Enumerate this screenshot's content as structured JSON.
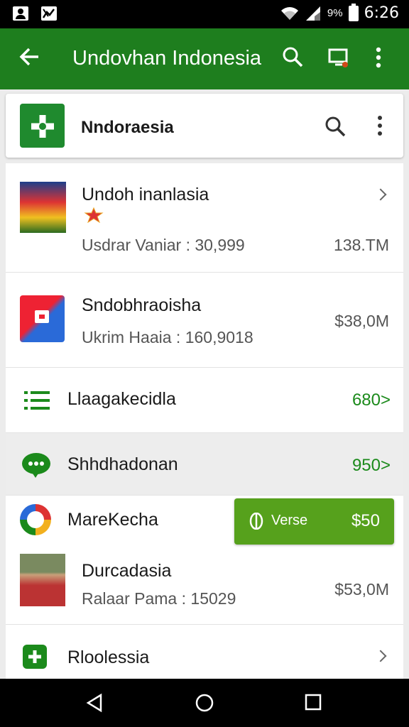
{
  "status_bar": {
    "battery_pct": "9%",
    "time": "6:26",
    "icons": [
      "person-icon",
      "chart-icon",
      "wifi-icon",
      "signal-icon",
      "battery-icon"
    ]
  },
  "app_bar": {
    "title": "Undovhan Indonesia",
    "icons": [
      "back-arrow-icon",
      "search-icon",
      "cast-icon",
      "more-vert-icon"
    ]
  },
  "search_card": {
    "title": "Nndoraesia"
  },
  "list": [
    {
      "title": "Undoh inanlasia",
      "subtitle": "Usdrar Vaniar : 30,999",
      "value": "138.TM"
    },
    {
      "title": "Sndobhraoisha",
      "subtitle": "Ukrim Haaia : 160,9018",
      "value": "$38,0M"
    },
    {
      "title": "Llaagakecidla",
      "value": "680>"
    },
    {
      "title": "Shhdhadonan",
      "value": "950>"
    },
    {
      "title": "MareKecha"
    },
    {
      "title": "Durcadasia",
      "subtitle": "Ralaar Pama : 15029",
      "value": "$53,0M"
    },
    {
      "title": "Rloolessia"
    }
  ],
  "verse_button": {
    "label": "Verse",
    "price": "$50"
  },
  "colors": {
    "app_bar": "#1e7e1e",
    "accent_green": "#1b8a1b",
    "button_green": "#56a11c",
    "selected_row": "#ededed"
  },
  "nav_bar": {
    "icons": [
      "back-triangle-icon",
      "home-circle-icon",
      "recents-square-icon"
    ]
  }
}
